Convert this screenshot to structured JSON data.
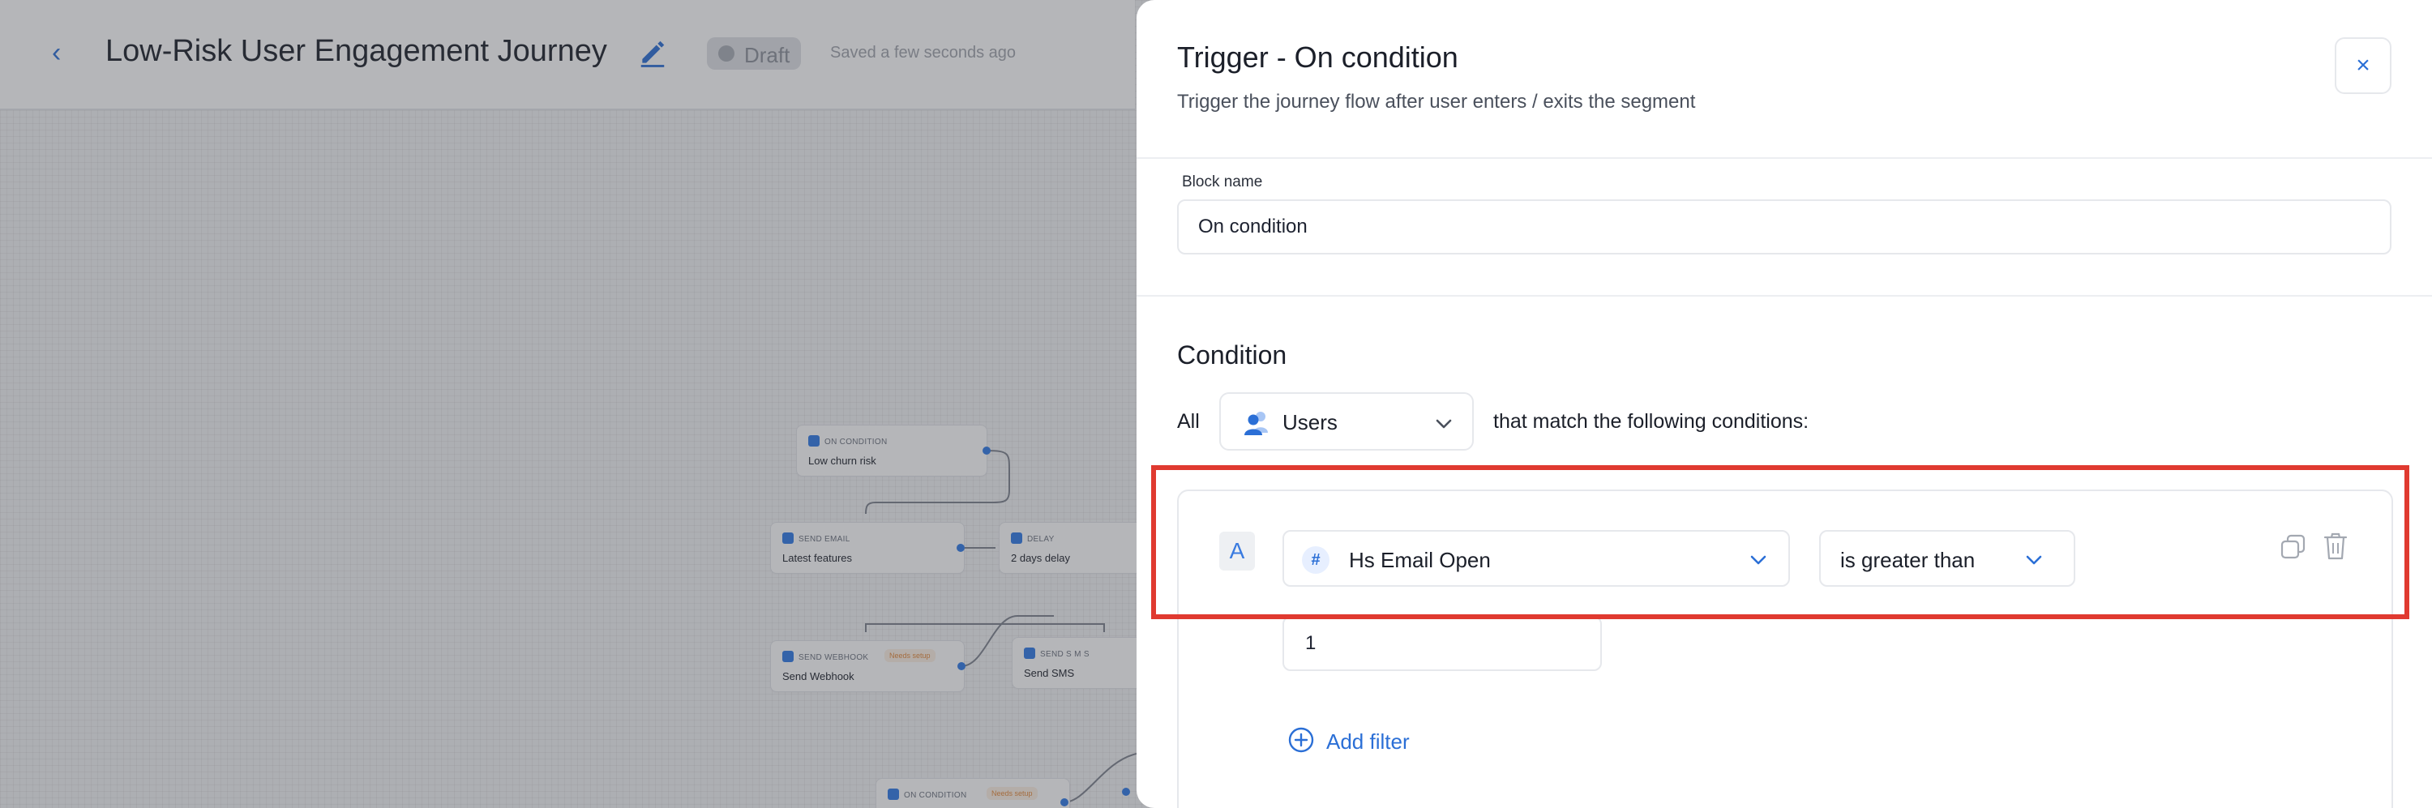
{
  "journey": {
    "title": "Low-Risk User Engagement Journey",
    "status": "Draft",
    "saved_text": "Saved a few seconds ago",
    "nodes": [
      {
        "tag": "ON CONDITION",
        "name": "Low churn risk",
        "badge": ""
      },
      {
        "tag": "SEND EMAIL",
        "name": "Latest features",
        "badge": ""
      },
      {
        "tag": "DELAY",
        "name": "2 days delay",
        "badge": ""
      },
      {
        "tag": "SEND WEBHOOK",
        "name": "Send Webhook",
        "badge": "Needs setup"
      },
      {
        "tag": "SEND S M S",
        "name": "Send SMS",
        "badge": ""
      },
      {
        "tag": "ON CONDITION",
        "name": "",
        "badge": "Needs setup"
      }
    ]
  },
  "drawer": {
    "title": "Trigger - On condition",
    "subtitle": "Trigger the journey flow after user enters / exits the segment",
    "close_symbol": "×",
    "block_name_label": "Block name",
    "block_name_value": "On condition",
    "condition_heading": "Condition",
    "all_label": "All",
    "entity_select": "Users",
    "match_text": "that match the following conditions:",
    "condition": {
      "letter": "A",
      "property": "Hs Email Open",
      "operator": "is greater than",
      "value": "1"
    },
    "add_filter_label": "Add filter"
  },
  "colors": {
    "accent": "#2b6fd6",
    "highlight": "#e03a30",
    "warning": "#e4893b"
  }
}
